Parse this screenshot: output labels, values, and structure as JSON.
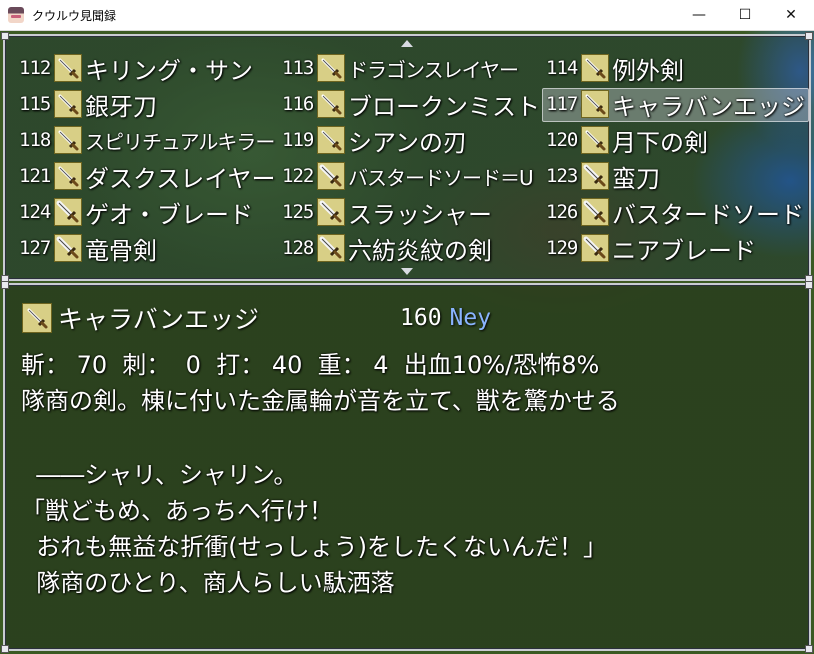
{
  "window": {
    "title": "クウルウ見聞録",
    "minimize_glyph": "—",
    "maximize_glyph": "☐",
    "close_glyph": "✕"
  },
  "item_list": {
    "items": [
      {
        "number": "112.",
        "name": "キリング・サン",
        "icon": "sword-icon"
      },
      {
        "number": "113.",
        "name": "ドラゴンスレイヤー",
        "icon": "sword-icon"
      },
      {
        "number": "114.",
        "name": "例外剣",
        "icon": "sword-icon"
      },
      {
        "number": "115.",
        "name": "銀牙刀",
        "icon": "sword-icon"
      },
      {
        "number": "116.",
        "name": "ブロークンミスト",
        "icon": "sword-icon"
      },
      {
        "number": "117.",
        "name": "キャラバンエッジ",
        "icon": "sword-icon",
        "selected": true
      },
      {
        "number": "118.",
        "name": "スピリチュアルキラー",
        "icon": "sword-icon"
      },
      {
        "number": "119.",
        "name": "シアンの刃",
        "icon": "sword-icon"
      },
      {
        "number": "120.",
        "name": "月下の剣",
        "icon": "sword-icon"
      },
      {
        "number": "121.",
        "name": "ダスクスレイヤー",
        "icon": "sword-icon"
      },
      {
        "number": "122.",
        "name": "バスタードソード＝U",
        "icon": "greatsword-icon"
      },
      {
        "number": "123.",
        "name": "蛮刀",
        "icon": "greatsword-icon"
      },
      {
        "number": "124.",
        "name": "ゲオ・ブレード",
        "icon": "greatsword-icon"
      },
      {
        "number": "125.",
        "name": "スラッシャー",
        "icon": "greatsword-icon"
      },
      {
        "number": "126.",
        "name": "バスタードソード",
        "icon": "greatsword-icon"
      },
      {
        "number": "127.",
        "name": "竜骨剣",
        "icon": "greatsword-icon"
      },
      {
        "number": "128.",
        "name": "六紡炎紋の剣",
        "icon": "greatsword-icon"
      },
      {
        "number": "129.",
        "name": "ニアブレード",
        "icon": "greatsword-icon"
      }
    ]
  },
  "detail": {
    "name": "キャラバンエッジ",
    "price": "160",
    "currency": "Ney",
    "stats": "斬： 70  刺：  0  打： 40  重： 4  出血10%/恐怖8%",
    "lines": [
      "隊商の剣。棟に付いた金属輪が音を立て、獣を驚かせる",
      "",
      "  ――シャリ、シャリン。",
      "「獣どもめ、あっちへ行け！",
      "  おれも無益な折衝(せっしょう)をしたくないんだ！」",
      "  隊商のひとり、商人らしい駄洒落"
    ]
  },
  "colors": {
    "icon_bg": "#d8cf86",
    "currency": "#8ab4ff",
    "selection": "#dcdceb"
  }
}
